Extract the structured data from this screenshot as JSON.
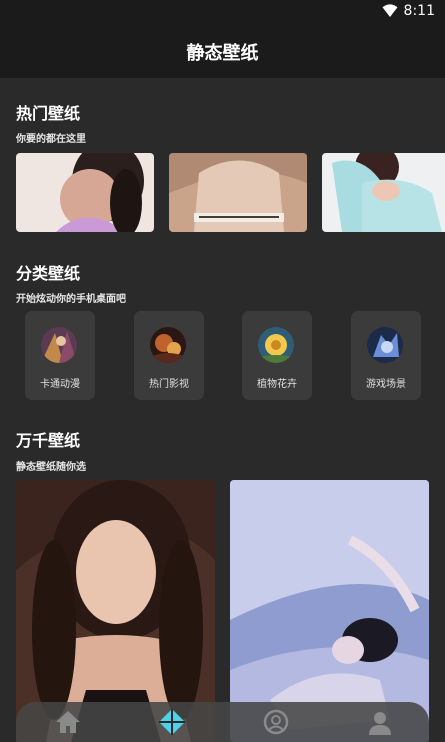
{
  "status_bar": {
    "time": "8:11"
  },
  "app_bar": {
    "title": "静态壁纸"
  },
  "hot_section": {
    "title": "热门壁纸",
    "subtitle": "你要的都在这里",
    "thumbnail_count": 3
  },
  "category_section": {
    "title": "分类壁纸",
    "subtitle": "开始炫动你的手机桌面吧",
    "items": [
      {
        "label": "卡通动漫"
      },
      {
        "label": "热门影视"
      },
      {
        "label": "植物花卉"
      },
      {
        "label": "游戏场景"
      }
    ]
  },
  "wallpaper_section": {
    "title": "万千壁纸",
    "subtitle": "静态壁纸随你选"
  },
  "bottom_nav": {
    "items": [
      {
        "icon": "home-icon",
        "active": false
      },
      {
        "icon": "diamond-logo-icon",
        "active": true
      },
      {
        "icon": "circle-face-icon",
        "active": false
      },
      {
        "icon": "user-icon",
        "active": false
      }
    ]
  },
  "colors": {
    "background": "#2a2a2a",
    "bar": "#1b1b1b",
    "card": "#3b3b3b",
    "accent": "#4fd1e8"
  }
}
